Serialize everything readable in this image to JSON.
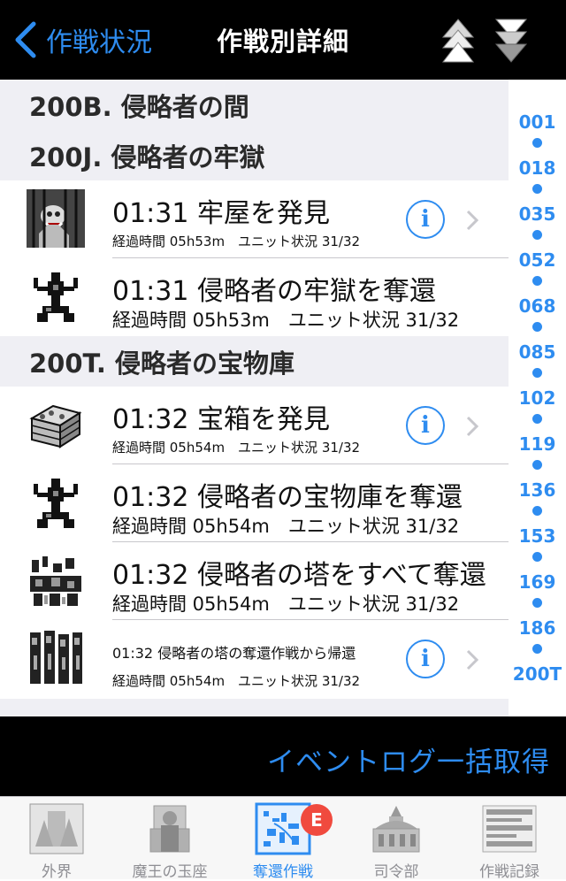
{
  "navbar": {
    "back_label": "作戦状況",
    "title": "作戦別詳細"
  },
  "sections": [
    {
      "header": "200B. 侵略者の間",
      "rows": []
    },
    {
      "header": "200J. 侵略者の牢獄",
      "rows": [
        {
          "title": "01:31 牢屋を発見",
          "sub": "経過時間 05h53m　ユニット状況 31/32",
          "icon": "prison-icon",
          "info": true
        },
        {
          "title": "01:31 侵略者の牢獄を奪還",
          "sub": "経過時間 05h53m　ユニット状況 31/32",
          "icon": "monster-icon",
          "info": false
        }
      ]
    },
    {
      "header": "200T. 侵略者の宝物庫",
      "rows": [
        {
          "title": "01:32 宝箱を発見",
          "sub": "経過時間 05h54m　ユニット状況 31/32",
          "icon": "treasure-chest-icon",
          "info": true
        },
        {
          "title": "01:32 侵略者の宝物庫を奪還",
          "sub": "経過時間 05h54m　ユニット状況 31/32",
          "icon": "monster-icon",
          "info": false
        },
        {
          "title": "01:32 侵略者の塔をすべて奪還",
          "sub": "経過時間 05h54m　ユニット状況 31/32",
          "icon": "battle-scene-icon",
          "info": false
        },
        {
          "title": "01:32 侵略者の塔の奪還作戦から帰還",
          "sub": "経過時間 05h54m　ユニット状況 31/32",
          "icon": "army-icon",
          "info": true
        }
      ]
    }
  ],
  "info_glyph": "i",
  "index": {
    "labels": [
      "001",
      "018",
      "035",
      "052",
      "068",
      "085",
      "102",
      "119",
      "136",
      "153",
      "169",
      "186",
      "200T"
    ]
  },
  "action_bar": {
    "label": "イベントログ一括取得"
  },
  "tabbar": {
    "tabs": [
      {
        "label": "外界",
        "icon": "outer-world-icon",
        "active": false
      },
      {
        "label": "魔王の玉座",
        "icon": "throne-icon",
        "active": false
      },
      {
        "label": "奪還作戦",
        "icon": "map-icon",
        "active": true
      },
      {
        "label": "司令部",
        "icon": "headquarters-icon",
        "active": false
      },
      {
        "label": "作戦記録",
        "icon": "records-icon",
        "active": false
      }
    ],
    "badge": "E"
  },
  "colors": {
    "accent": "#2e8cf0",
    "bar_background": "#000000",
    "section_background": "#efeff4",
    "badge": "#f04a3e"
  }
}
